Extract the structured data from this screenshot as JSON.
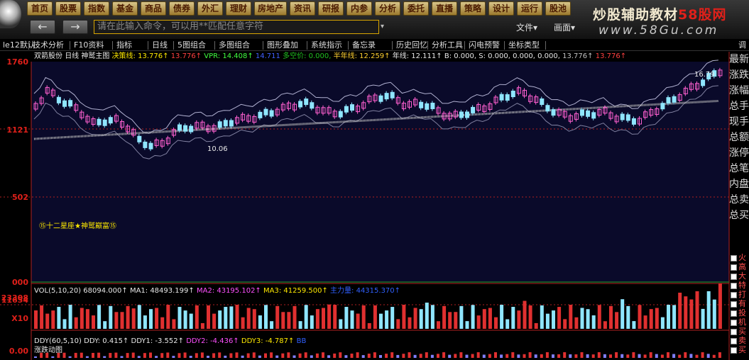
{
  "menu": [
    "首页",
    "股票",
    "指数",
    "基金",
    "商品",
    "债券",
    "外汇",
    "理财",
    "房地产",
    "资讯",
    "研报",
    "内参",
    "分析",
    "委托",
    "直播",
    "策略",
    "设计",
    "运行",
    "股池"
  ],
  "nav": {
    "back": "←",
    "forward": "→"
  },
  "command": {
    "placeholder": "请在此输入命令，可以用**匹配任意字符"
  },
  "file_menu": [
    "文件▾",
    "画面▾"
  ],
  "brand": {
    "text": "炒股辅助教材",
    "highlight": "58股网",
    "url": "www.58Gu.com"
  },
  "toolbar": {
    "items": [
      "le12默认",
      "技术分析",
      "F10资料",
      "指标",
      "日线",
      "5图组合",
      "多图组合",
      "图形叠加",
      "系统指示",
      "备忘录",
      "历史回忆",
      "分析工具",
      "闪电预警",
      "坐标类型"
    ],
    "right": "调"
  },
  "main_info": {
    "name": "双箭股份",
    "period": "日线",
    "formula": "神鹫主图",
    "decision_label": "决策线:",
    "decision_val": "13.776↑",
    "v2": "13.776↑",
    "v3_label": "VPR:",
    "v3": "14.408↑",
    "v4": "14.711",
    "v5": "多空价: 0.000,",
    "v6": "半年线: 12.259↑",
    "v7": "年线: 12.111↑",
    "v8": "B: 0.000,",
    "v9": "S: 0.000,",
    "v10": "0.000,",
    "v11": "0.000,",
    "v12": "13.776↑",
    "v13": "13.776↑"
  },
  "y_axis_main": [
    "1760",
    "1121",
    "502",
    "000"
  ],
  "chart_annotations": {
    "peak": "16.79",
    "low": "10.06",
    "caption": "⑮十二星座★神鹫巅富⑮"
  },
  "right_panel": [
    "最新",
    "涨跌",
    "涨幅",
    "总手",
    "现手",
    "总额",
    "涨停",
    "总笔",
    "内盘",
    "总卖",
    "总买"
  ],
  "right_checks": [
    "火",
    "高",
    "大",
    "特",
    "打",
    "有",
    "投",
    "机",
    "买",
    "卖",
    "买"
  ],
  "vol_info": {
    "label": "VOL(5,10,20)",
    "v": "68094.000↑",
    "ma1": "MA1: 48493.199↑",
    "ma2": "MA2: 43195.102↑",
    "ma3": "MA3: 41259.500↑",
    "ma4": "主力量: 44315.370↑"
  },
  "y_axis_vol": [
    "23308",
    "11654",
    "X10"
  ],
  "ddy_info": {
    "label": "DDY(60,5,10)",
    "ddy": "DDY: 0.415↑",
    "ddy1": "DDY1: -3.552↑",
    "ddy2": "DDY2: -4.436↑",
    "ddy3": "DDY3: -4.787↑",
    "extra": "BB"
  },
  "ddy_sub": "涨跌动图",
  "y_axis_ddy": [
    "0.00"
  ],
  "colors": {
    "up": "#ff60d0",
    "down": "#8fe6ff",
    "ma_gray": "#b8b8b8",
    "bg": "#000000",
    "axis": "#b02020"
  }
}
